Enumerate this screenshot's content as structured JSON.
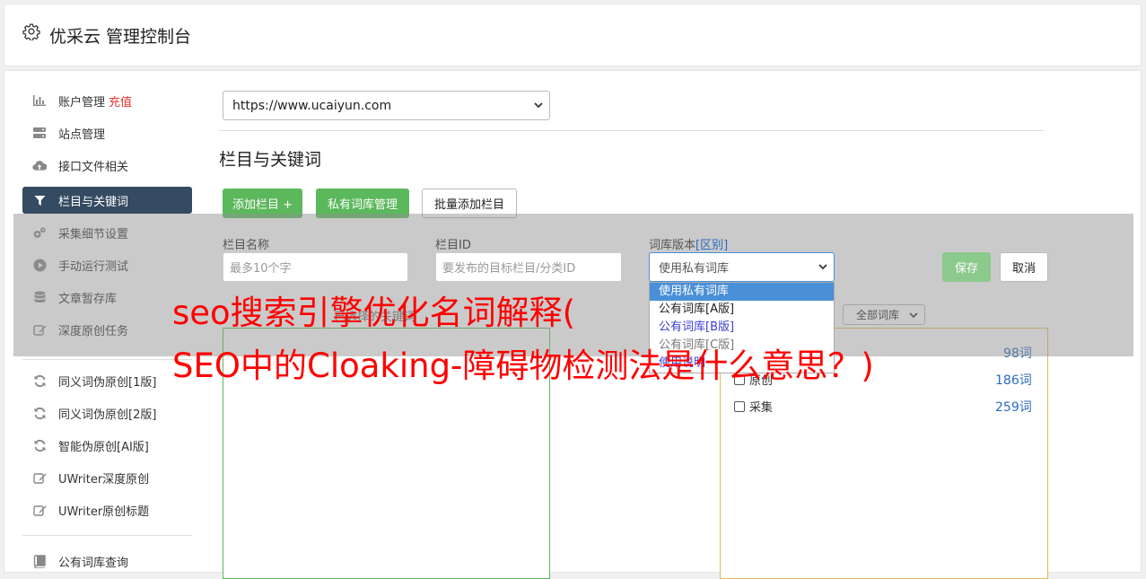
{
  "header": {
    "title": "优采云 管理控制台"
  },
  "sidebar": {
    "items": [
      {
        "label": "账户管理",
        "extra": "充值",
        "icon": "bar-chart-icon"
      },
      {
        "label": "站点管理",
        "icon": "server-icon"
      },
      {
        "label": "接口文件相关",
        "icon": "cloud-upload-icon"
      },
      {
        "label": "栏目与关键词",
        "icon": "filter-icon"
      },
      {
        "label": "采集细节设置",
        "icon": "gears-icon"
      },
      {
        "label": "手动运行测试",
        "icon": "play-circle-icon"
      },
      {
        "label": "文章暂存库",
        "icon": "database-icon"
      },
      {
        "label": "深度原创任务",
        "icon": "edit-icon"
      },
      {
        "label": "同义词伪原创[1版]",
        "icon": "refresh-icon"
      },
      {
        "label": "同义词伪原创[2版]",
        "icon": "refresh-icon"
      },
      {
        "label": "智能伪原创[AI版]",
        "icon": "refresh-icon"
      },
      {
        "label": "UWriter深度原创",
        "icon": "edit-icon"
      },
      {
        "label": "UWriter原创标题",
        "icon": "edit-icon"
      },
      {
        "label": "公有词库查询",
        "icon": "book-icon"
      }
    ]
  },
  "site_select": {
    "value": "https://www.ucaiyun.com"
  },
  "section_title": "栏目与关键词",
  "buttons": {
    "add_column": "添加栏目 +",
    "private_lib": "私有词库管理",
    "batch_add": "批量添加栏目",
    "save": "保存",
    "cancel": "取消"
  },
  "form": {
    "name_label": "栏目名称",
    "name_placeholder": "最多10个字",
    "id_label": "栏目ID",
    "id_placeholder": "要发布的目标栏目/分类ID",
    "version_label": "词库版本",
    "version_link": "[区别]",
    "version_value": "使用私有词库"
  },
  "dropdown_options": [
    "使用私有词库",
    "公有词库[A版]",
    "公有词库[B版]",
    "公有词库[C版]"
  ],
  "filter_select": "全部词库",
  "partial_texts": {
    "left_header": "已选择的关键词",
    "link_text": "使用说明",
    "original": "原创"
  },
  "word_rows": [
    {
      "label": "",
      "count": "98词"
    },
    {
      "label": "原创",
      "count": "186词"
    },
    {
      "label": "采集",
      "count": "259词"
    }
  ],
  "watermark": {
    "line1": "seo搜索引擎优化名词解释(",
    "line2": "SEO中的Cloaking-障碍物检测法是什么意思？)"
  },
  "colors": {
    "accent_green": "#5cb85c",
    "nav_active": "#354b62",
    "watermark": "#ff0000",
    "count_blue": "#2a6bbf"
  }
}
